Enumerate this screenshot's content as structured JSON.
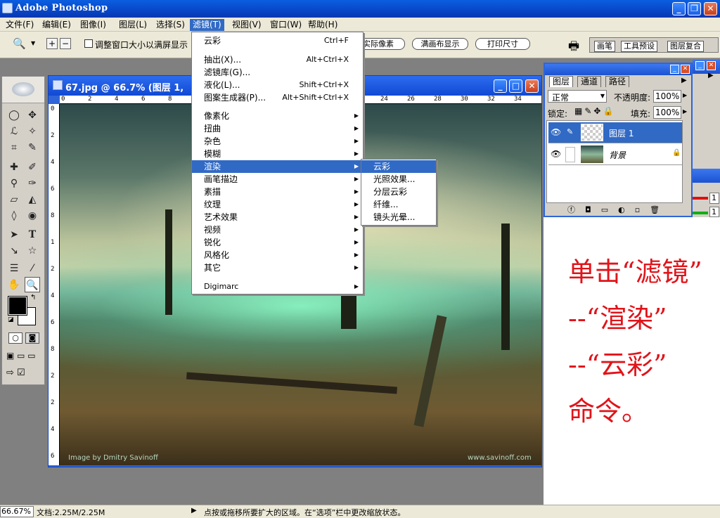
{
  "app": {
    "title": "Adobe Photoshop"
  },
  "menubar": [
    "文件(F)",
    "编辑(E)",
    "图像(I)",
    "图层(L)",
    "选择(S)",
    "滤镜(T)",
    "视图(V)",
    "窗口(W)",
    "帮助(H)"
  ],
  "options": {
    "checkbox_label": "调整窗口大小以满屏显示",
    "btn_actual": "实际像素",
    "btn_fit": "满画布显示",
    "btn_print": "打印尺寸",
    "tabs": [
      "画笔",
      "工具预设",
      "图层复合"
    ]
  },
  "document": {
    "title": "67.jpg @ 66.7% (图层 1,",
    "ruler_h": [
      "0",
      "2",
      "4",
      "6",
      "8",
      "24",
      "26",
      "28",
      "30",
      "32",
      "34"
    ],
    "ruler_v": [
      "0",
      "2",
      "4",
      "6",
      "8",
      "1",
      "2",
      "4",
      "6",
      "8",
      "2",
      "2",
      "4",
      "6"
    ],
    "credit_left": "Image by Dmitry Savinoff",
    "credit_right": "www.savinoff.com"
  },
  "filter_menu": {
    "top": [
      {
        "label": "云彩",
        "shortcut": "Ctrl+F"
      }
    ],
    "group2": [
      {
        "label": "抽出(X)...",
        "shortcut": "Alt+Ctrl+X"
      },
      {
        "label": "滤镜库(G)...",
        "shortcut": ""
      },
      {
        "label": "液化(L)...",
        "shortcut": "Shift+Ctrl+X"
      },
      {
        "label": "图案生成器(P)...",
        "shortcut": "Alt+Shift+Ctrl+X"
      }
    ],
    "group3": [
      "像素化",
      "扭曲",
      "杂色",
      "模糊",
      "渲染",
      "画笔描边",
      "素描",
      "纹理",
      "艺术效果",
      "视频",
      "锐化",
      "风格化",
      "其它"
    ],
    "group4": [
      "Digimarc"
    ],
    "highlighted": "渲染"
  },
  "render_submenu": [
    "云彩",
    "光照效果...",
    "分层云彩",
    "纤维...",
    "镜头光晕..."
  ],
  "layers_panel": {
    "tabs": [
      "图层",
      "通道",
      "路径"
    ],
    "blend_mode": "正常",
    "opacity_label": "不透明度:",
    "opacity_value": "100%",
    "lock_label": "锁定:",
    "fill_label": "填充:",
    "fill_value": "100%",
    "layers": [
      {
        "name": "图层 1",
        "selected": true
      },
      {
        "name": "背景",
        "selected": false
      }
    ]
  },
  "side_values": [
    "1",
    "1"
  ],
  "annotation": [
    "单击“滤镜”",
    "--“渲染”",
    "--“云彩”",
    "命令。"
  ],
  "status": {
    "zoom": "66.67%",
    "doc": "文档:2.25M/2.25M",
    "hint": "点按或拖移所要扩大的区域。在“选项”栏中更改缩放状态。"
  },
  "colors": {
    "accent": "#316ac5",
    "annotation": "#e0141a",
    "titlebar": "#0a5fe0"
  }
}
